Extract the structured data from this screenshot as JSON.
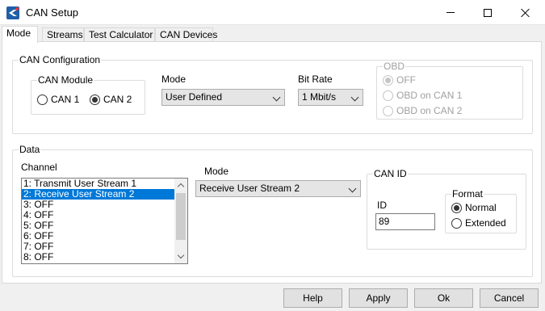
{
  "window": {
    "title": "CAN Setup"
  },
  "tabs": [
    {
      "label": "Mode",
      "active": true
    },
    {
      "label": "Streams",
      "active": false
    },
    {
      "label": "Test Calculator",
      "active": false
    },
    {
      "label": "CAN Devices",
      "active": false
    }
  ],
  "can_config": {
    "group_label": "CAN Configuration",
    "module": {
      "label": "CAN Module",
      "options": [
        {
          "label": "CAN 1",
          "checked": false
        },
        {
          "label": "CAN 2",
          "checked": true
        }
      ]
    },
    "mode": {
      "label": "Mode",
      "value": "User Defined"
    },
    "bit_rate": {
      "label": "Bit Rate",
      "value": "1 Mbit/s"
    },
    "obd": {
      "label": "OBD",
      "enabled": false,
      "options": [
        {
          "label": "OFF",
          "checked": true
        },
        {
          "label": "OBD on CAN 1",
          "checked": false
        },
        {
          "label": "OBD on CAN 2",
          "checked": false
        }
      ]
    }
  },
  "data": {
    "group_label": "Data",
    "channel": {
      "label": "Channel",
      "items": [
        "1: Transmit User Stream 1",
        "2: Receive User Stream 2",
        "3: OFF",
        "4: OFF",
        "5: OFF",
        "6: OFF",
        "7: OFF",
        "8: OFF"
      ],
      "selected_index": 1
    },
    "mode": {
      "label": "Mode",
      "value": "Receive User Stream 2"
    },
    "can_id": {
      "label": "CAN ID",
      "id_label": "ID",
      "id_value": "89",
      "format": {
        "label": "Format",
        "options": [
          {
            "label": "Normal",
            "checked": true
          },
          {
            "label": "Extended",
            "checked": false
          }
        ]
      }
    }
  },
  "buttons": {
    "help": "Help",
    "apply": "Apply",
    "ok": "Ok",
    "cancel": "Cancel"
  }
}
